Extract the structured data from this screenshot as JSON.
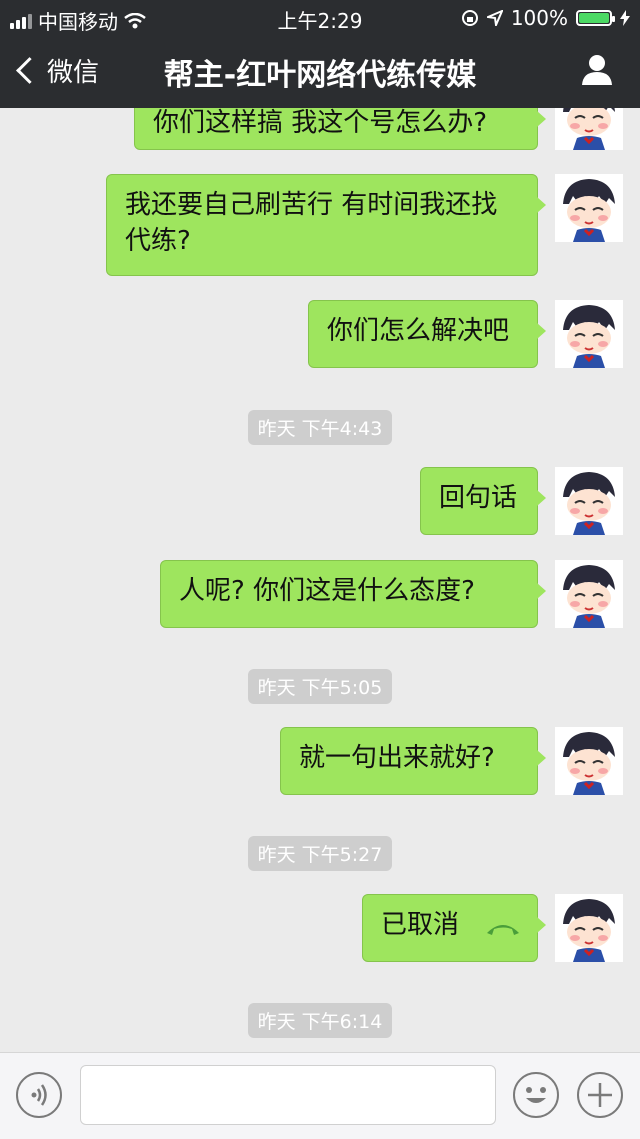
{
  "status_bar": {
    "carrier": "中国移动",
    "time": "上午2:29",
    "battery": "100%"
  },
  "nav": {
    "back_label": "微信",
    "title": "帮主-红叶网络代练传媒"
  },
  "messages": {
    "m1": "你们这样搞 我这个号怎么办?",
    "m2_line1": "我还要自己刷苦行 有时间我还找",
    "m2_line2": "代练?",
    "m3": "你们怎么解决吧",
    "t1": "昨天 下午4:43",
    "m4": "回句话",
    "m5": "人呢?  你们这是什么态度?",
    "t2": "昨天 下午5:05",
    "m6": "就一句出来就好?",
    "t3": "昨天 下午5:27",
    "m7": "已取消",
    "t4": "昨天 下午6:14"
  },
  "colors": {
    "bubble": "#9ee55e",
    "topbar": "#2b2d30",
    "background": "#ebebeb"
  }
}
